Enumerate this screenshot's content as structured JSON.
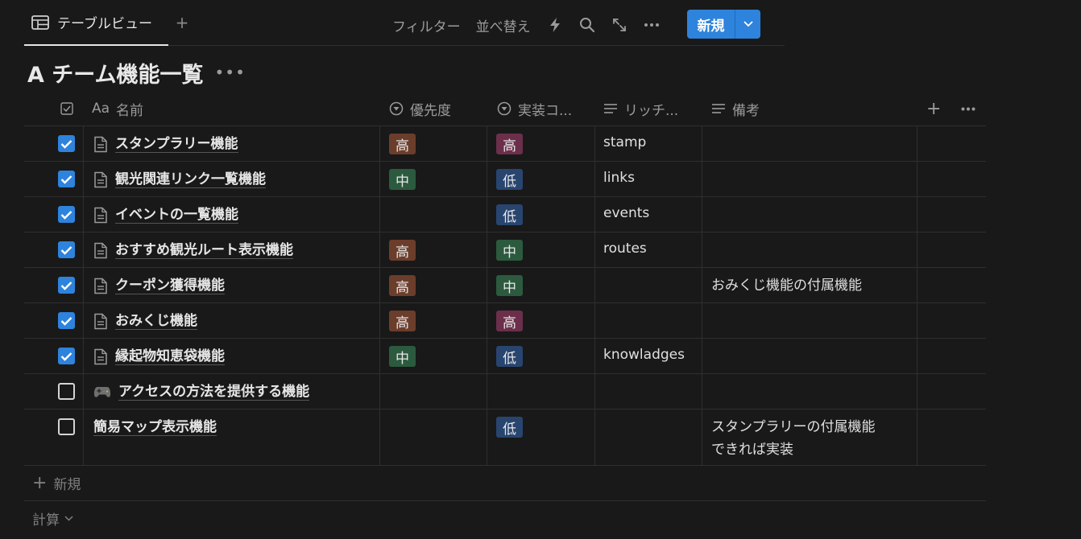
{
  "view_tab": {
    "label": "テーブルビュー",
    "icon": "table-icon"
  },
  "toolbar": {
    "filter": "フィルター",
    "sort": "並べ替え",
    "new_label": "新規"
  },
  "page": {
    "title": "A チーム機能一覧"
  },
  "columns": {
    "name": "名前",
    "priority": "優先度",
    "cost": "実装コ...",
    "rich": "リッチ...",
    "note": "備考",
    "aa": "Aa"
  },
  "colors": {
    "accent": "#2e83dc",
    "tag_high_priority": "#6b3d2b",
    "tag_mid": "#2c5a3f",
    "tag_high_cost": "#6b2f4b",
    "tag_low": "#28456f"
  },
  "rows": [
    {
      "checked": true,
      "icon": "page-icon",
      "name": "スタンプラリー機能",
      "priority": "高",
      "cost": "高",
      "rich": "stamp",
      "note": ""
    },
    {
      "checked": true,
      "icon": "page-icon",
      "name": "観光関連リンク一覧機能",
      "priority": "中",
      "cost": "低",
      "rich": "links",
      "note": ""
    },
    {
      "checked": true,
      "icon": "page-icon",
      "name": "イベントの一覧機能",
      "priority": "",
      "cost": "低",
      "rich": "events",
      "note": ""
    },
    {
      "checked": true,
      "icon": "page-icon",
      "name": "おすすめ観光ルート表示機能",
      "priority": "高",
      "cost": "中",
      "rich": "routes",
      "note": ""
    },
    {
      "checked": true,
      "icon": "page-icon",
      "name": "クーポン獲得機能",
      "priority": "高",
      "cost": "中",
      "rich": "",
      "note": "おみくじ機能の付属機能"
    },
    {
      "checked": true,
      "icon": "page-icon",
      "name": "おみくじ機能",
      "priority": "高",
      "cost": "高",
      "rich": "",
      "note": ""
    },
    {
      "checked": true,
      "icon": "page-icon",
      "name": "縁起物知恵袋機能",
      "priority": "中",
      "cost": "低",
      "rich": "knowladges",
      "note": ""
    },
    {
      "checked": false,
      "icon": "gamepad-icon",
      "name": "アクセスの方法を提供する機能",
      "priority": "",
      "cost": "",
      "rich": "",
      "note": ""
    },
    {
      "checked": false,
      "icon": "",
      "name": "簡易マップ表示機能",
      "priority": "",
      "cost": "低",
      "rich": "",
      "note": "スタンプラリーの付属機能",
      "note2": "できれば実装"
    }
  ],
  "footer": {
    "new_row": "新規",
    "calculate": "計算"
  }
}
